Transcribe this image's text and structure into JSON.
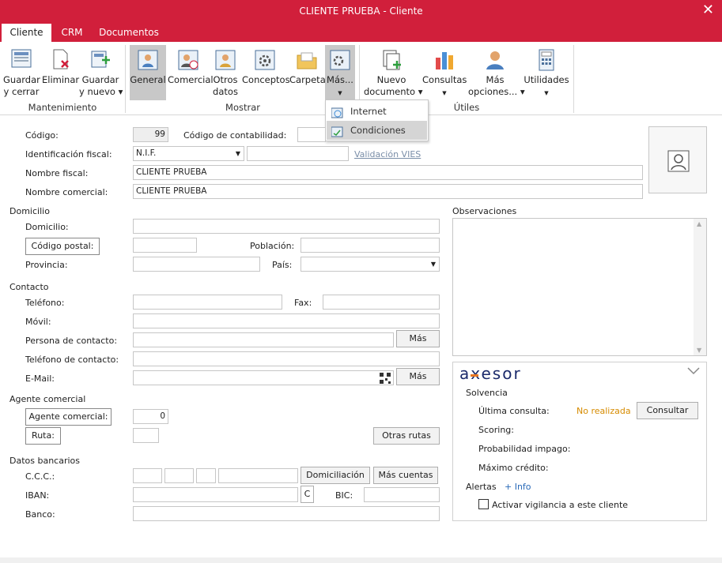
{
  "window": {
    "title": "CLIENTE PRUEBA - Cliente",
    "close_icon": "close-icon"
  },
  "tabs": [
    {
      "label": "Cliente"
    },
    {
      "label": "CRM"
    },
    {
      "label": "Documentos"
    }
  ],
  "ribbon": {
    "groups": {
      "mantenimiento": "Mantenimiento",
      "mostrar": "Mostrar",
      "utiles": "Útiles"
    },
    "buttons": {
      "guardar": "Guardar\ny cerrar",
      "eliminar": "Eliminar",
      "guardar_nuevo": "Guardar\ny nuevo ▾",
      "general": "General",
      "comercial": "Comercial",
      "otros": "Otros\ndatos",
      "conceptos": "Conceptos",
      "carpeta": "Carpeta",
      "mas": "Más...",
      "nuevo_doc": "Nuevo\ndocumento ▾",
      "consultas": "Consultas",
      "mas_opciones": "Más\nopciones... ▾",
      "utilidades": "Utilidades"
    },
    "menu": {
      "internet": "Internet",
      "condiciones": "Condiciones"
    }
  },
  "form": {
    "codigo_label": "Código:",
    "codigo_value": "99",
    "contabilidad_label": "Código de contabilidad:",
    "idfiscal_label": "Identificación fiscal:",
    "idfiscal_type": "N.I.F.",
    "vies_link": "Validación VIES",
    "nombre_fiscal_label": "Nombre fiscal:",
    "nombre_fiscal_value": "CLIENTE PRUEBA",
    "nombre_comercial_label": "Nombre comercial:",
    "nombre_comercial_value": "CLIENTE PRUEBA",
    "domicilio_section": "Domicilio",
    "domicilio_label": "Domicilio:",
    "cp_button": "Código postal:",
    "poblacion_label": "Población:",
    "provincia_label": "Provincia:",
    "pais_label": "País:",
    "contacto_section": "Contacto",
    "telefono_label": "Teléfono:",
    "fax_label": "Fax:",
    "movil_label": "Móvil:",
    "persona_label": "Persona de contacto:",
    "mas_button": "Más",
    "tel_contacto_label": "Teléfono de contacto:",
    "email_label": "E-Mail:",
    "agente_section": "Agente comercial",
    "agente_button": "Agente comercial:",
    "agente_value": "0",
    "ruta_button": "Ruta:",
    "otras_rutas_button": "Otras rutas",
    "bancarios_section": "Datos bancarios",
    "ccc_label": "C.C.C.:",
    "domiciliacion_button": "Domiciliación",
    "mas_cuentas_button": "Más cuentas",
    "iban_label": "IBAN:",
    "iban_c": "C",
    "bic_label": "BIC:",
    "banco_label": "Banco:",
    "observaciones_label": "Observaciones"
  },
  "axesor": {
    "logo": "axesor",
    "solvencia": "Solvencia",
    "ultima_label": "Última consulta:",
    "ultima_value": "No realizada",
    "consultar_button": "Consultar",
    "scoring_label": "Scoring:",
    "impago_label": "Probabilidad impago:",
    "credito_label": "Máximo crédito:",
    "alertas_label": "Alertas",
    "info_link": "+ Info",
    "vigilancia_label": "Activar vigilancia a este cliente",
    "accent_color": "#e87722",
    "status_color": "#d68b00"
  }
}
